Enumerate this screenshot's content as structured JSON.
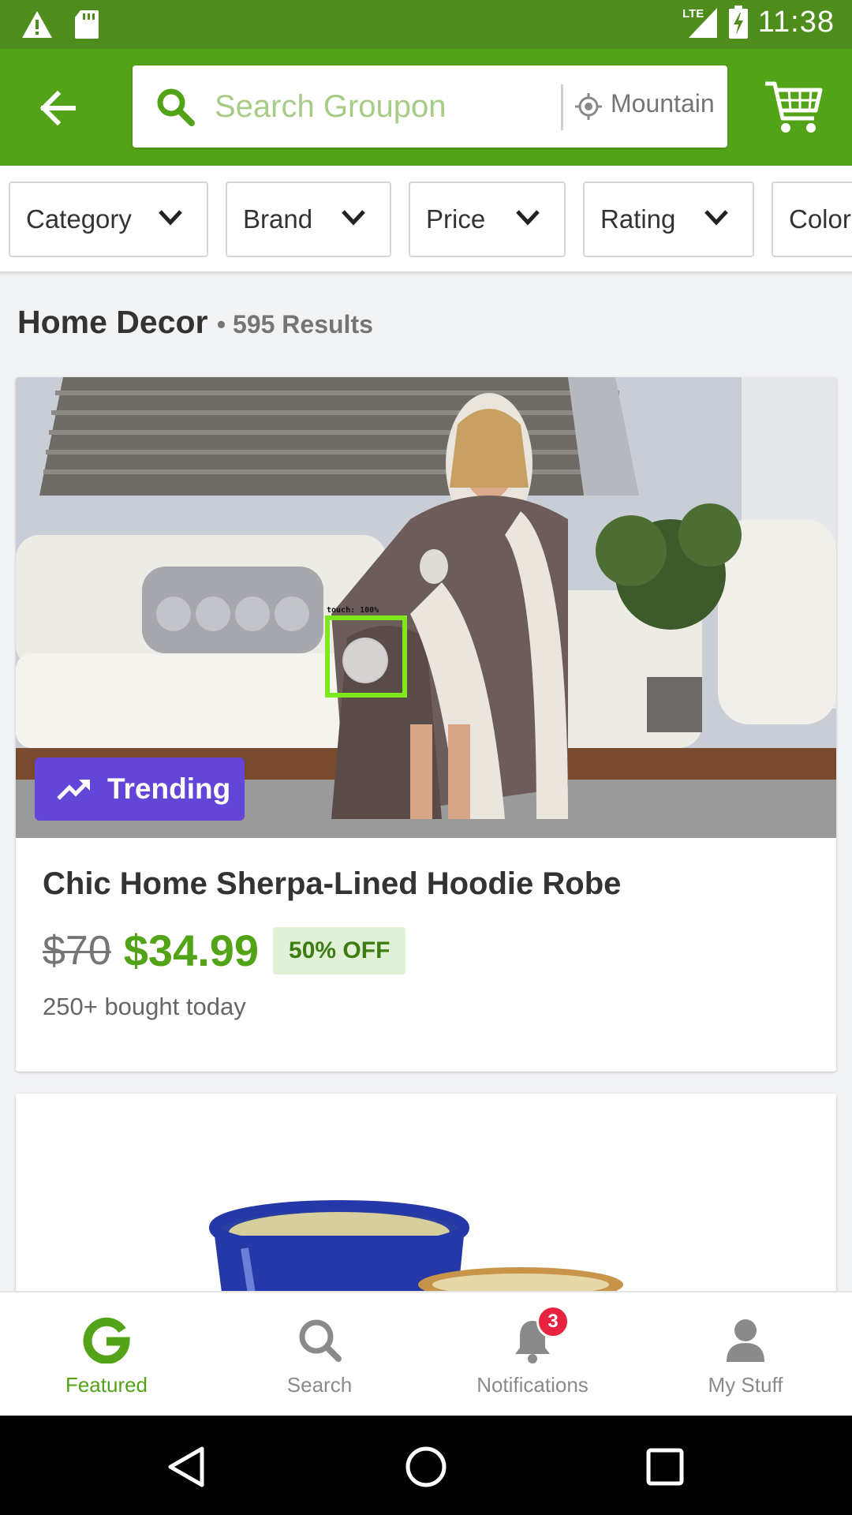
{
  "status_bar": {
    "time": "11:38",
    "network": "LTE",
    "icons": [
      "warning-icon",
      "sd-card-icon",
      "signal-icon",
      "battery-charging-icon"
    ]
  },
  "app_bar": {
    "search_placeholder": "Search Groupon",
    "location_text": "Mountain View",
    "colors": {
      "bar": "#53a318",
      "status": "#4e8d1c"
    }
  },
  "filters": [
    {
      "label": "Category"
    },
    {
      "label": "Brand"
    },
    {
      "label": "Price"
    },
    {
      "label": "Rating"
    },
    {
      "label": "Color"
    }
  ],
  "results": {
    "category": "Home Decor",
    "count_text": "• 595 Results"
  },
  "deal": {
    "badge": "Trending",
    "title": "Chic Home Sherpa-Lined Hoodie Robe",
    "old_price": "$70",
    "new_price": "$34.99",
    "discount": "50% OFF",
    "bought": "250+ bought today",
    "touch_label": "touch: 100%"
  },
  "bottom_nav": {
    "items": [
      {
        "label": "Featured",
        "icon": "groupon-g-icon",
        "active": true
      },
      {
        "label": "Search",
        "icon": "search-icon",
        "active": false
      },
      {
        "label": "Notifications",
        "icon": "bell-icon",
        "active": false
      },
      {
        "label": "My Stuff",
        "icon": "person-icon",
        "active": false
      }
    ],
    "notification_count": "3"
  }
}
